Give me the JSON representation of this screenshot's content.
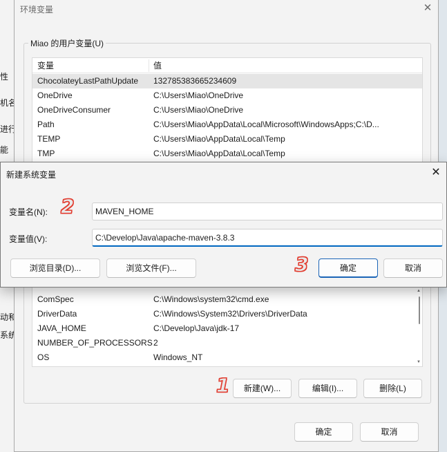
{
  "background_window": {
    "fragments": [
      "性",
      "机名",
      "进行",
      "能",
      "动和",
      "系统属"
    ]
  },
  "env_dialog": {
    "title": "环境变量",
    "close_glyph": "✕",
    "user_group_label": "Miao 的用户变量(U)",
    "columns": [
      "变量",
      "值"
    ],
    "user_variables": [
      {
        "name": "ChocolateyLastPathUpdate",
        "value": "132785383665234609"
      },
      {
        "name": "OneDrive",
        "value": "C:\\Users\\Miao\\OneDrive"
      },
      {
        "name": "OneDriveConsumer",
        "value": "C:\\Users\\Miao\\OneDrive"
      },
      {
        "name": "Path",
        "value": "C:\\Users\\Miao\\AppData\\Local\\Microsoft\\WindowsApps;C:\\D..."
      },
      {
        "name": "TEMP",
        "value": "C:\\Users\\Miao\\AppData\\Local\\Temp"
      },
      {
        "name": "TMP",
        "value": "C:\\Users\\Miao\\AppData\\Local\\Temp"
      }
    ],
    "system_variables": [
      {
        "name": "ComSpec",
        "value": "C:\\Windows\\system32\\cmd.exe"
      },
      {
        "name": "DriverData",
        "value": "C:\\Windows\\System32\\Drivers\\DriverData"
      },
      {
        "name": "JAVA_HOME",
        "value": "C:\\Develop\\Java\\jdk-17"
      },
      {
        "name": "NUMBER_OF_PROCESSORS",
        "value": "2"
      },
      {
        "name": "OS",
        "value": "Windows_NT"
      }
    ],
    "buttons": {
      "new": "新建(W)...",
      "edit": "编辑(I)...",
      "delete": "删除(L)"
    },
    "footer": {
      "ok": "确定",
      "cancel": "取消"
    }
  },
  "new_variable_dialog": {
    "title": "新建系统变量",
    "close_glyph": "✕",
    "name_label": "变量名(N):",
    "name_value": "MAVEN_HOME",
    "value_label": "变量值(V):",
    "value_value": "C:\\Develop\\Java\\apache-maven-3.8.3",
    "browse_dir": "浏览目录(D)...",
    "browse_file": "浏览文件(F)...",
    "ok": "确定",
    "cancel": "取消"
  },
  "callouts": {
    "one": "1",
    "two": "2",
    "three": "3"
  },
  "colors": {
    "accent": "#0067c0",
    "callout": "#e23b2e"
  }
}
